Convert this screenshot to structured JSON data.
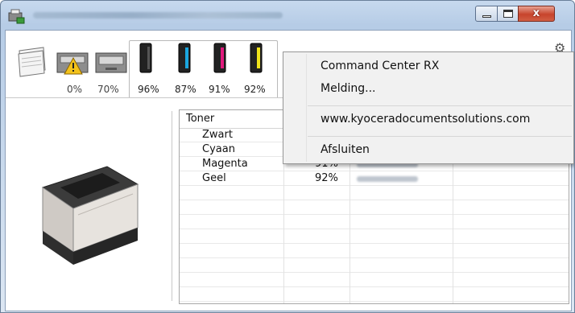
{
  "window": {
    "controls": {
      "minimize_glyph": "—",
      "maximize_glyph": "□",
      "close_glyph": "x"
    }
  },
  "toolbar": {
    "tabs": [
      {
        "label": "",
        "icon": "paper-stack-icon"
      },
      {
        "label": "0%",
        "icon": "paper-tray-warning-icon"
      },
      {
        "label": "70%",
        "icon": "paper-tray-icon"
      }
    ],
    "toner_tabs": [
      {
        "label": "96%",
        "icon": "black-toner-icon",
        "color": "#1b1b1b"
      },
      {
        "label": "87%",
        "icon": "cyan-toner-icon",
        "color": "#1aa6df"
      },
      {
        "label": "91%",
        "icon": "magenta-toner-icon",
        "color": "#e0197d"
      },
      {
        "label": "92%",
        "icon": "yellow-toner-icon",
        "color": "#efe21a"
      }
    ],
    "settings_icon": "gear-icon"
  },
  "table": {
    "header": "Toner",
    "rows": [
      {
        "name": "Zwart",
        "level": ""
      },
      {
        "name": "Cyaan",
        "level": ""
      },
      {
        "name": "Magenta",
        "level": "91%"
      },
      {
        "name": "Geel",
        "level": "92%"
      }
    ]
  },
  "context_menu": {
    "items": [
      "Command Center RX",
      "Melding...",
      "www.kyoceradocumentsolutions.com",
      "Afsluiten"
    ]
  },
  "colors": {
    "accent": "#c7d9ee",
    "menu_bg": "#f1f1f1",
    "close_red": "#c7442c"
  }
}
